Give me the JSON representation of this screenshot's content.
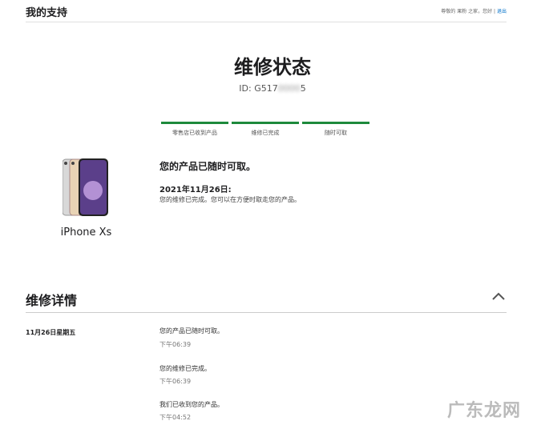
{
  "header": {
    "brand": "我的支持",
    "greeting": "尊敬的 果粉 之家，您好",
    "separator": "|",
    "logout": "退出"
  },
  "repair": {
    "title": "维修状态",
    "id_label": "ID: G517",
    "id_masked": "0000",
    "id_suffix": "5",
    "steps": [
      {
        "label": "零售店已收到产品"
      },
      {
        "label": "维修已完成"
      },
      {
        "label": "随时可取"
      }
    ],
    "progress_completed_steps": 3,
    "product": "iPhone Xs",
    "status_headline": "您的产品已随时可取。",
    "status_date": "2021年11月26日:",
    "status_text": "您的维修已完成。您可以在方便时取走您的产品。"
  },
  "details": {
    "title": "维修详情",
    "date": "11月26日星期五",
    "events": [
      {
        "text": "您的产品已随时可取。",
        "time": "下午06:39"
      },
      {
        "text": "您的维修已完成。",
        "time": "下午06:39"
      },
      {
        "text": "我们已收到您的产品。",
        "time": "下午04:52"
      }
    ]
  },
  "watermark": "广东龙网"
}
